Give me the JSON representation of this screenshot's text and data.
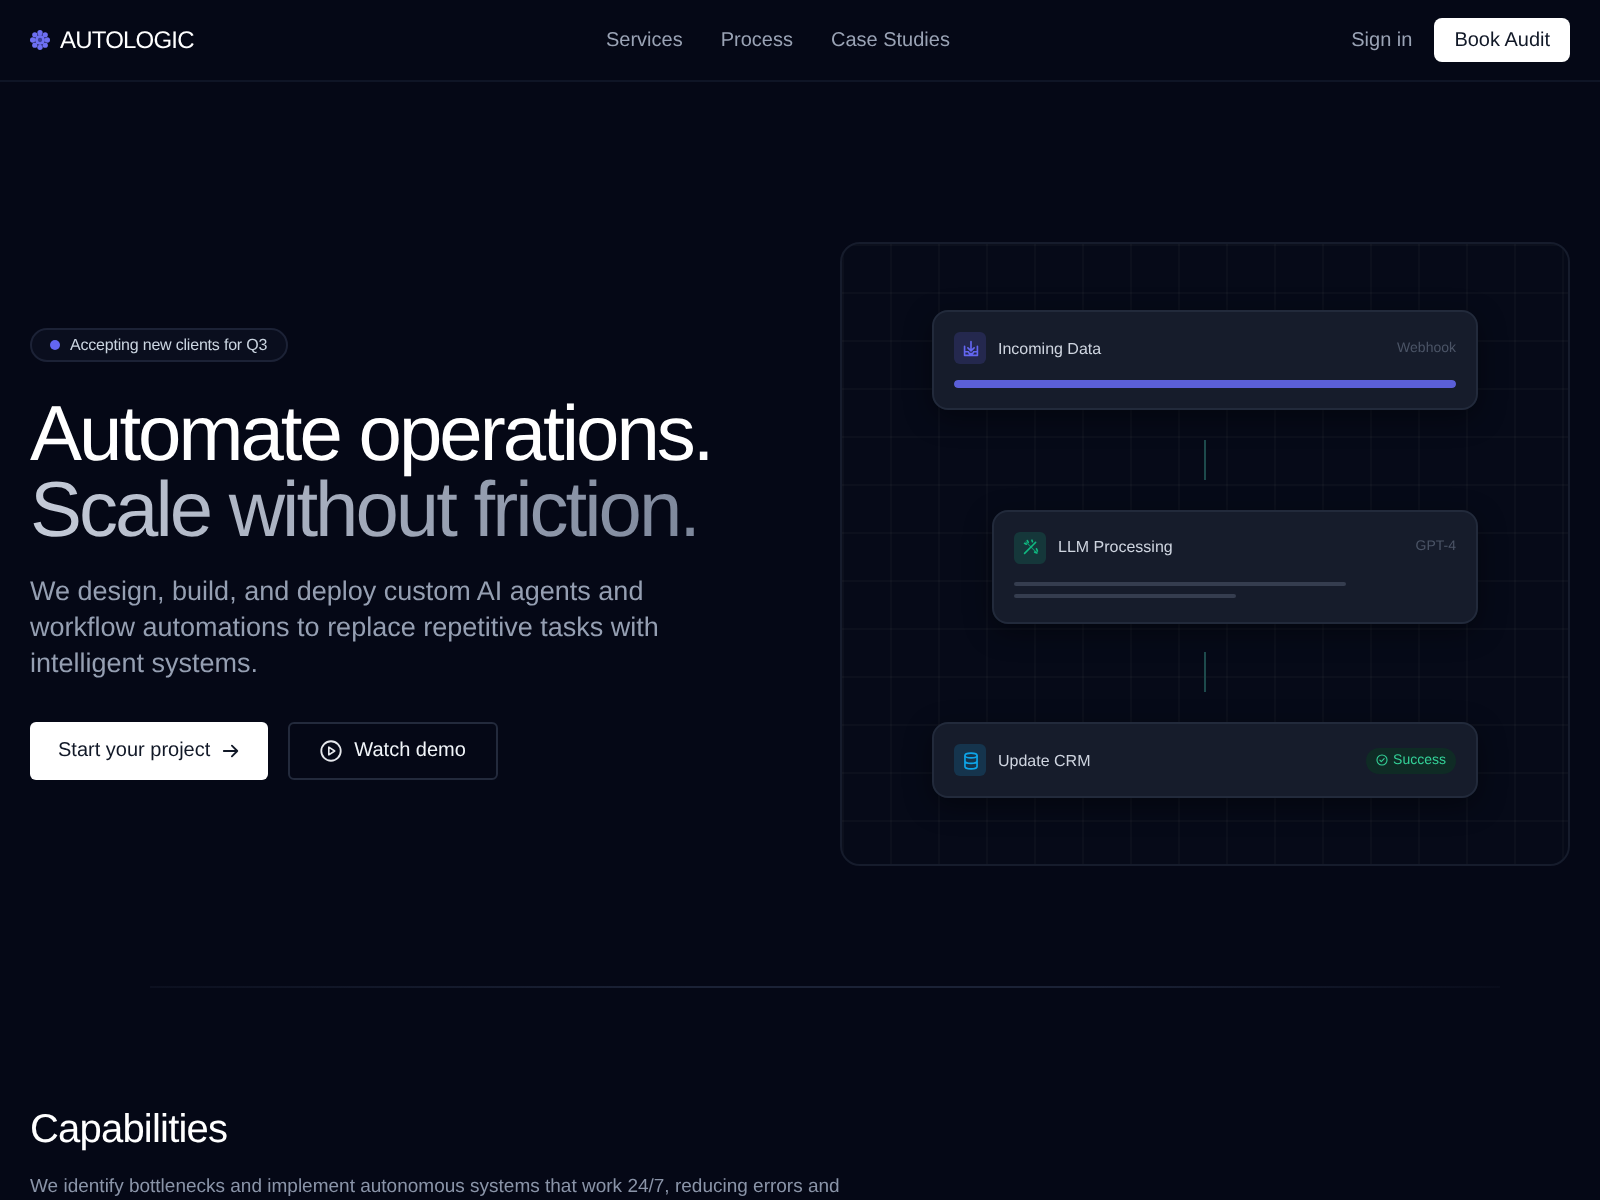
{
  "nav": {
    "brand": "AUTOLOGIC",
    "links": [
      {
        "label": "Services"
      },
      {
        "label": "Process"
      },
      {
        "label": "Case Studies"
      }
    ],
    "sign_in": "Sign in",
    "cta": "Book Audit"
  },
  "hero": {
    "badge": "Accepting new clients for Q3",
    "title_lines": [
      {
        "text": "Automate operations.",
        "kind": "strong"
      },
      {
        "text": "Scale without friction.",
        "kind": "muted"
      }
    ],
    "description": "We design, build, and deploy custom AI agents and workflow automations to replace repetitive tasks with intelligent systems.",
    "buttons": [
      {
        "label": "Start your project",
        "kind": "primary"
      },
      {
        "label": "Watch demo",
        "kind": "secondary"
      }
    ]
  },
  "workflow": {
    "nodes": [
      {
        "kind": "input",
        "title": "Incoming Data",
        "tag": "Webhook",
        "color": "#6366f1",
        "level": 1
      },
      {
        "kind": "process",
        "title": "LLM Processing",
        "tag": "GPT-4",
        "color": "#10b981"
      },
      {
        "kind": "output",
        "title": "Update CRM",
        "status": "Success",
        "color": "#0ea5e9"
      }
    ]
  },
  "capabilities": {
    "title": "Capabilities",
    "description": "We identify bottlenecks and implement autonomous systems that work 24/7, reducing errors and"
  }
}
